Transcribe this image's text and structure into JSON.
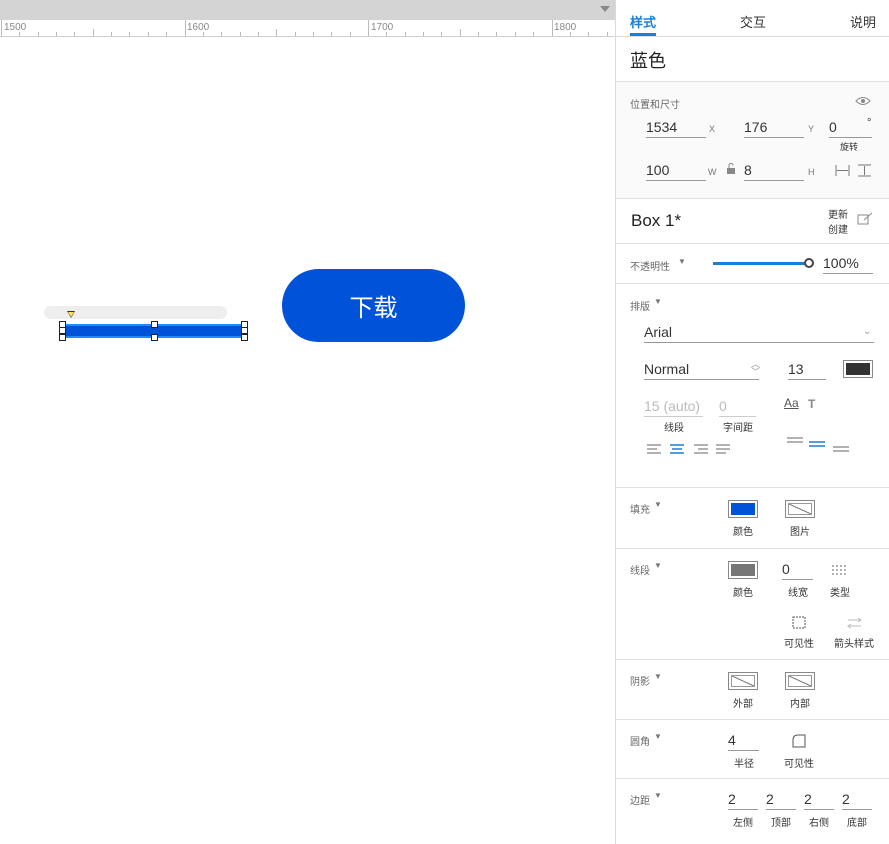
{
  "ruler": {
    "labels": [
      "1500",
      "1600",
      "1700",
      "1800"
    ]
  },
  "canvas": {
    "download_button": "下载",
    "progress_fraction": 1.0
  },
  "panel": {
    "tabs": [
      "样式",
      "交互",
      "说明"
    ],
    "style_name": "蓝色",
    "position_size": {
      "title": "位置和尺寸",
      "x": "1534",
      "x_label": "X",
      "y": "176",
      "y_label": "Y",
      "rotation": "0",
      "rotation_unit": "°",
      "rotation_label": "旋转",
      "w": "100",
      "w_label": "W",
      "h": "8",
      "h_label": "H"
    },
    "box": {
      "name": "Box 1*",
      "update": "更新",
      "create": "创建"
    },
    "opacity": {
      "label": "不透明性",
      "value": "100%",
      "fraction": 1.0
    },
    "typography": {
      "label": "排版",
      "font": "Arial",
      "weight": "Normal",
      "size": "13",
      "color": "#333333",
      "line_spacing": "15 (auto)",
      "line_spacing_label": "线段",
      "char_spacing": "0",
      "char_spacing_label": "字间距"
    },
    "fill": {
      "label": "填充",
      "color_label": "颜色",
      "image_label": "图片",
      "color": "#0052d9"
    },
    "stroke": {
      "label": "线段",
      "color_label": "颜色",
      "color": "#777777",
      "width": "0",
      "width_label": "线宽",
      "type_label": "类型",
      "visibility_label": "可见性",
      "arrow_label": "箭头样式"
    },
    "shadow": {
      "label": "阴影",
      "outer": "外部",
      "inner": "内部"
    },
    "corner": {
      "label": "圆角",
      "radius": "4",
      "radius_label": "半径",
      "visibility_label": "可见性"
    },
    "padding": {
      "label": "边距",
      "left": "2",
      "left_label": "左侧",
      "top": "2",
      "top_label": "顶部",
      "right": "2",
      "right_label": "右侧",
      "bottom": "2",
      "bottom_label": "底部"
    }
  },
  "colors": {
    "accent": "#1a7fd6",
    "button": "#0052d9"
  }
}
